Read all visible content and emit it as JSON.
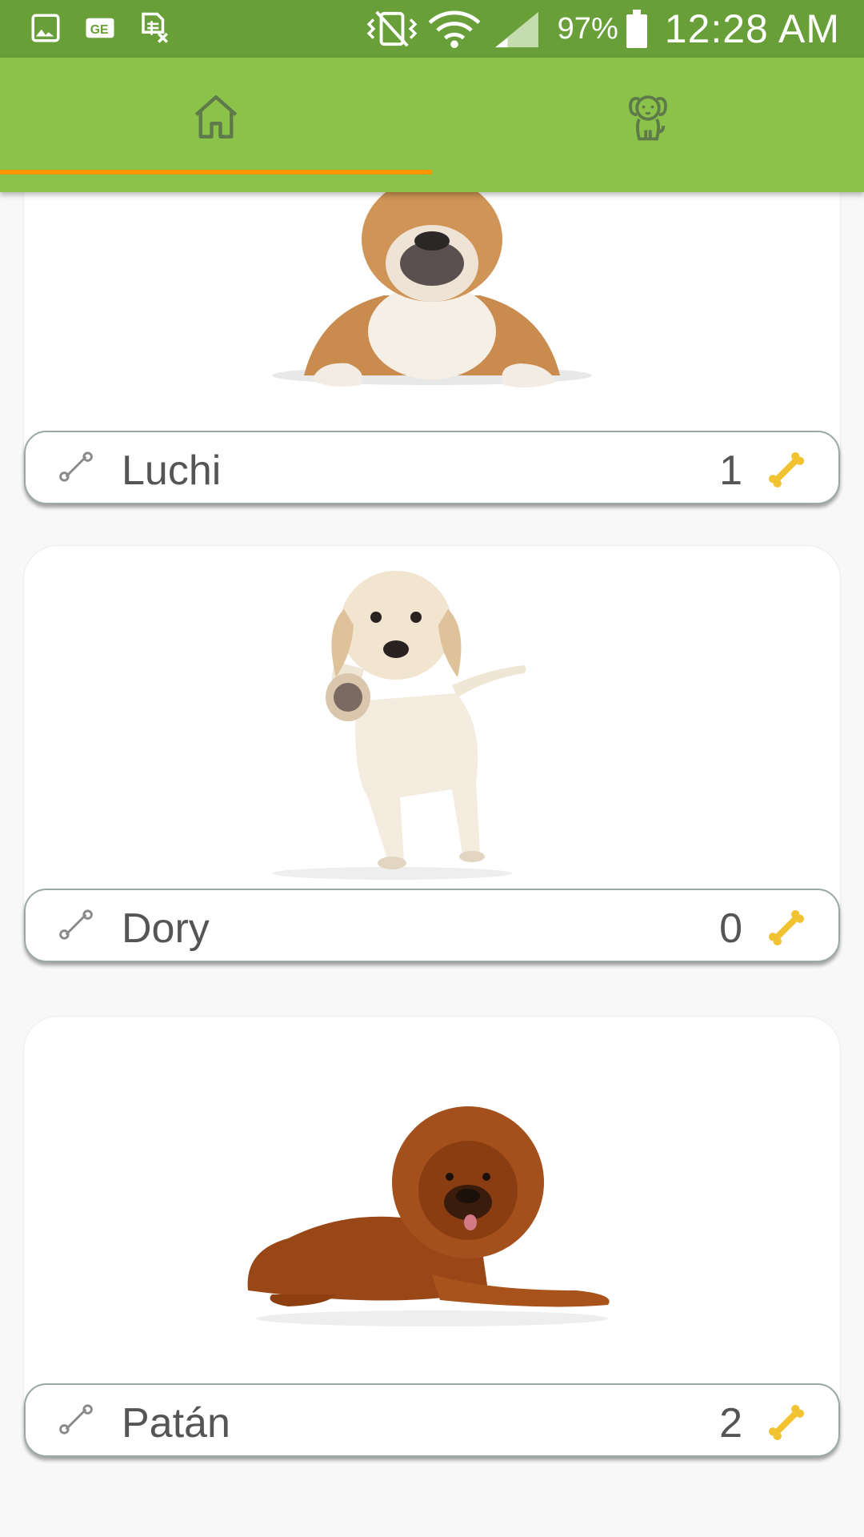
{
  "status_bar": {
    "battery": "97%",
    "time": "12:28 AM",
    "icons": [
      "gallery-icon",
      "ge-icon",
      "sheet-x-icon",
      "vibrate-icon",
      "wifi-icon",
      "signal-icon",
      "battery-icon"
    ]
  },
  "tabs": [
    {
      "icon": "home-icon",
      "selected": true
    },
    {
      "icon": "dog-icon",
      "selected": false
    }
  ],
  "colors": {
    "status_bar": "#689f38",
    "app_bar": "#8bc34a",
    "tab_indicator": "#ff9800",
    "bone_active": "#f2c230"
  },
  "dogs": [
    {
      "name": "Luchi",
      "likes": "1",
      "photo": "bulldog"
    },
    {
      "name": "Dory",
      "likes": "0",
      "photo": "labrador puppy"
    },
    {
      "name": "Patán",
      "likes": "2",
      "photo": "tibetan mastiff"
    }
  ]
}
